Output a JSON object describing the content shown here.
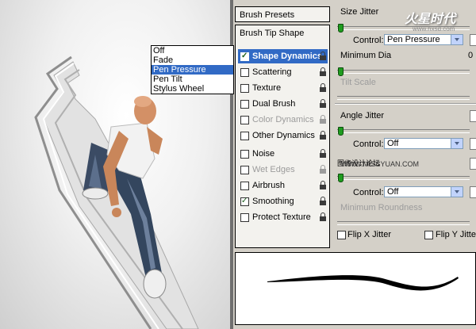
{
  "brush_presets_label": "Brush Presets",
  "brush_tip_label": "Brush Tip Shape",
  "items": [
    {
      "label": "Shape Dynamics",
      "checked": true,
      "active": true,
      "enabled": true
    },
    {
      "label": "Scattering",
      "checked": false,
      "active": false,
      "enabled": true
    },
    {
      "label": "Texture",
      "checked": false,
      "active": false,
      "enabled": true
    },
    {
      "label": "Dual Brush",
      "checked": false,
      "active": false,
      "enabled": true
    },
    {
      "label": "Color Dynamics",
      "checked": false,
      "active": false,
      "enabled": false
    },
    {
      "label": "Other Dynamics",
      "checked": false,
      "active": false,
      "enabled": true
    },
    {
      "label": "Noise",
      "checked": false,
      "active": false,
      "enabled": true
    },
    {
      "label": "Wet Edges",
      "checked": false,
      "active": false,
      "enabled": false
    },
    {
      "label": "Airbrush",
      "checked": false,
      "active": false,
      "enabled": true
    },
    {
      "label": "Smoothing",
      "checked": true,
      "active": false,
      "enabled": true
    },
    {
      "label": "Protect Texture",
      "checked": false,
      "active": false,
      "enabled": true
    }
  ],
  "size_jitter_label": "Size Jitter",
  "control_label": "Control:",
  "control_size_value": "Pen Pressure",
  "minimum_diameter_label": "Minimum Dia",
  "min_dia_value": "0",
  "tilt_scale_label": "Tilt Scale",
  "dropdown_options": [
    "Off",
    "Fade",
    "Pen Pressure",
    "Pen Tilt",
    "Stylus Wheel"
  ],
  "dropdown_selected": "Pen Pressure",
  "angle_jitter_label": "Angle Jitter",
  "control_angle_value": "Off",
  "roundness_jitter_label": "图缘设计论坛",
  "control_roundness_value": "Off",
  "minimum_roundness_label": "Minimum Roundness",
  "flip_x_label": "Flip X Jitter",
  "flip_y_label": "Flip Y Jitter",
  "watermark_text": "火星时代",
  "watermark_url": "www.hxsd.com",
  "watermark2": "WWW.MISSYUAN.COM",
  "accent_color": "#316ac5"
}
